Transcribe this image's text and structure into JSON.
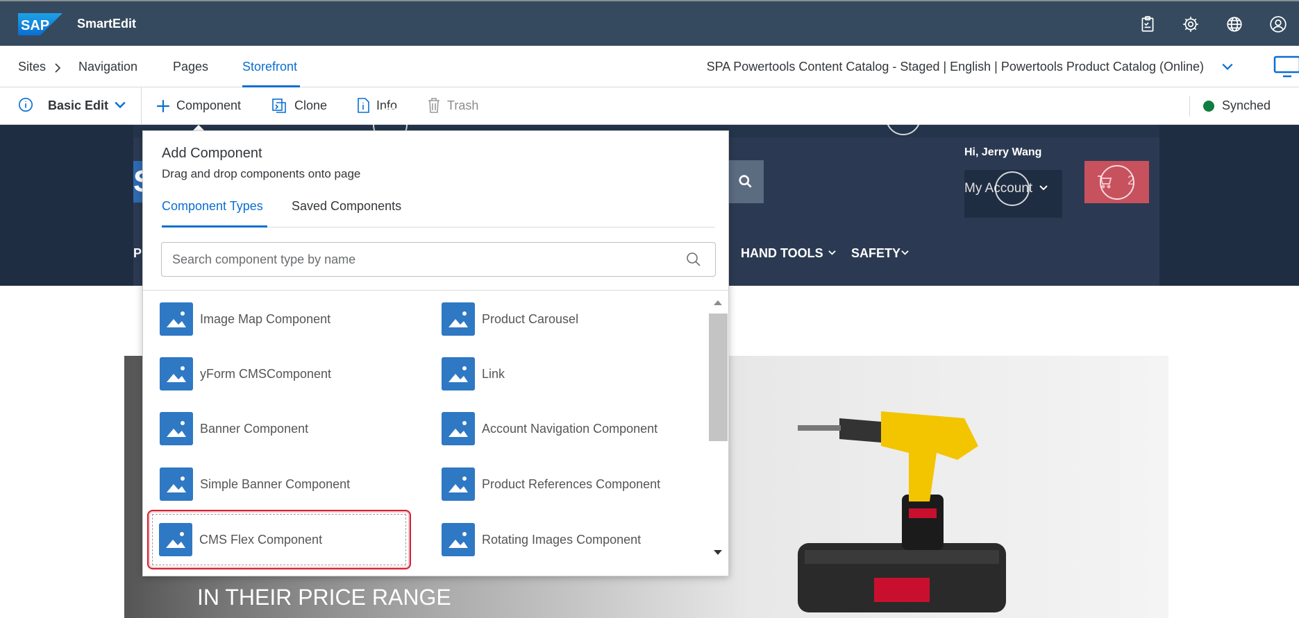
{
  "shell": {
    "app_name": "SmartEdit",
    "logo_text": "SAP",
    "icons": [
      "clipboard-icon",
      "gear-icon",
      "globe-icon",
      "user-icon"
    ]
  },
  "nav": {
    "breadcrumb_sites": "Sites",
    "tabs": [
      "Navigation",
      "Pages",
      "Storefront"
    ],
    "active_tab": "Storefront",
    "catalog": "SPA Powertools Content Catalog - Staged | English | Powertools Product Catalog (Online)"
  },
  "toolbar": {
    "mode": "Basic Edit",
    "component": "Component",
    "clone": "Clone",
    "info": "Info",
    "trash": "Trash",
    "sync_status": "Synched",
    "sync_color": "#107e3e"
  },
  "storefront": {
    "greeting": "Hi, Jerry Wang",
    "my_account": "My Account",
    "cart_count": "2",
    "menu": [
      "HAND TOOLS",
      "SAFETY"
    ],
    "menu_clipped": "P",
    "logo_clipped": "S",
    "hero_text": "IN THEIR PRICE RANGE"
  },
  "popover": {
    "title": "Add Component",
    "subtitle": "Drag and drop components onto page",
    "tabs": [
      "Component Types",
      "Saved Components"
    ],
    "search_placeholder": "Search component type by name",
    "components_left": [
      "Image Map Component",
      "yForm CMSComponent",
      "Banner Component",
      "Simple Banner Component",
      "CMS Flex Component"
    ],
    "components_right": [
      "Product Carousel",
      "Link",
      "Account Navigation Component",
      "Product References Component",
      "Rotating Images Component"
    ],
    "highlighted": "CMS Flex Component"
  },
  "colors": {
    "shell": "#354a5f",
    "accent": "#0a6ed1",
    "component_icon": "#2f78c4",
    "highlight": "#d32030"
  }
}
